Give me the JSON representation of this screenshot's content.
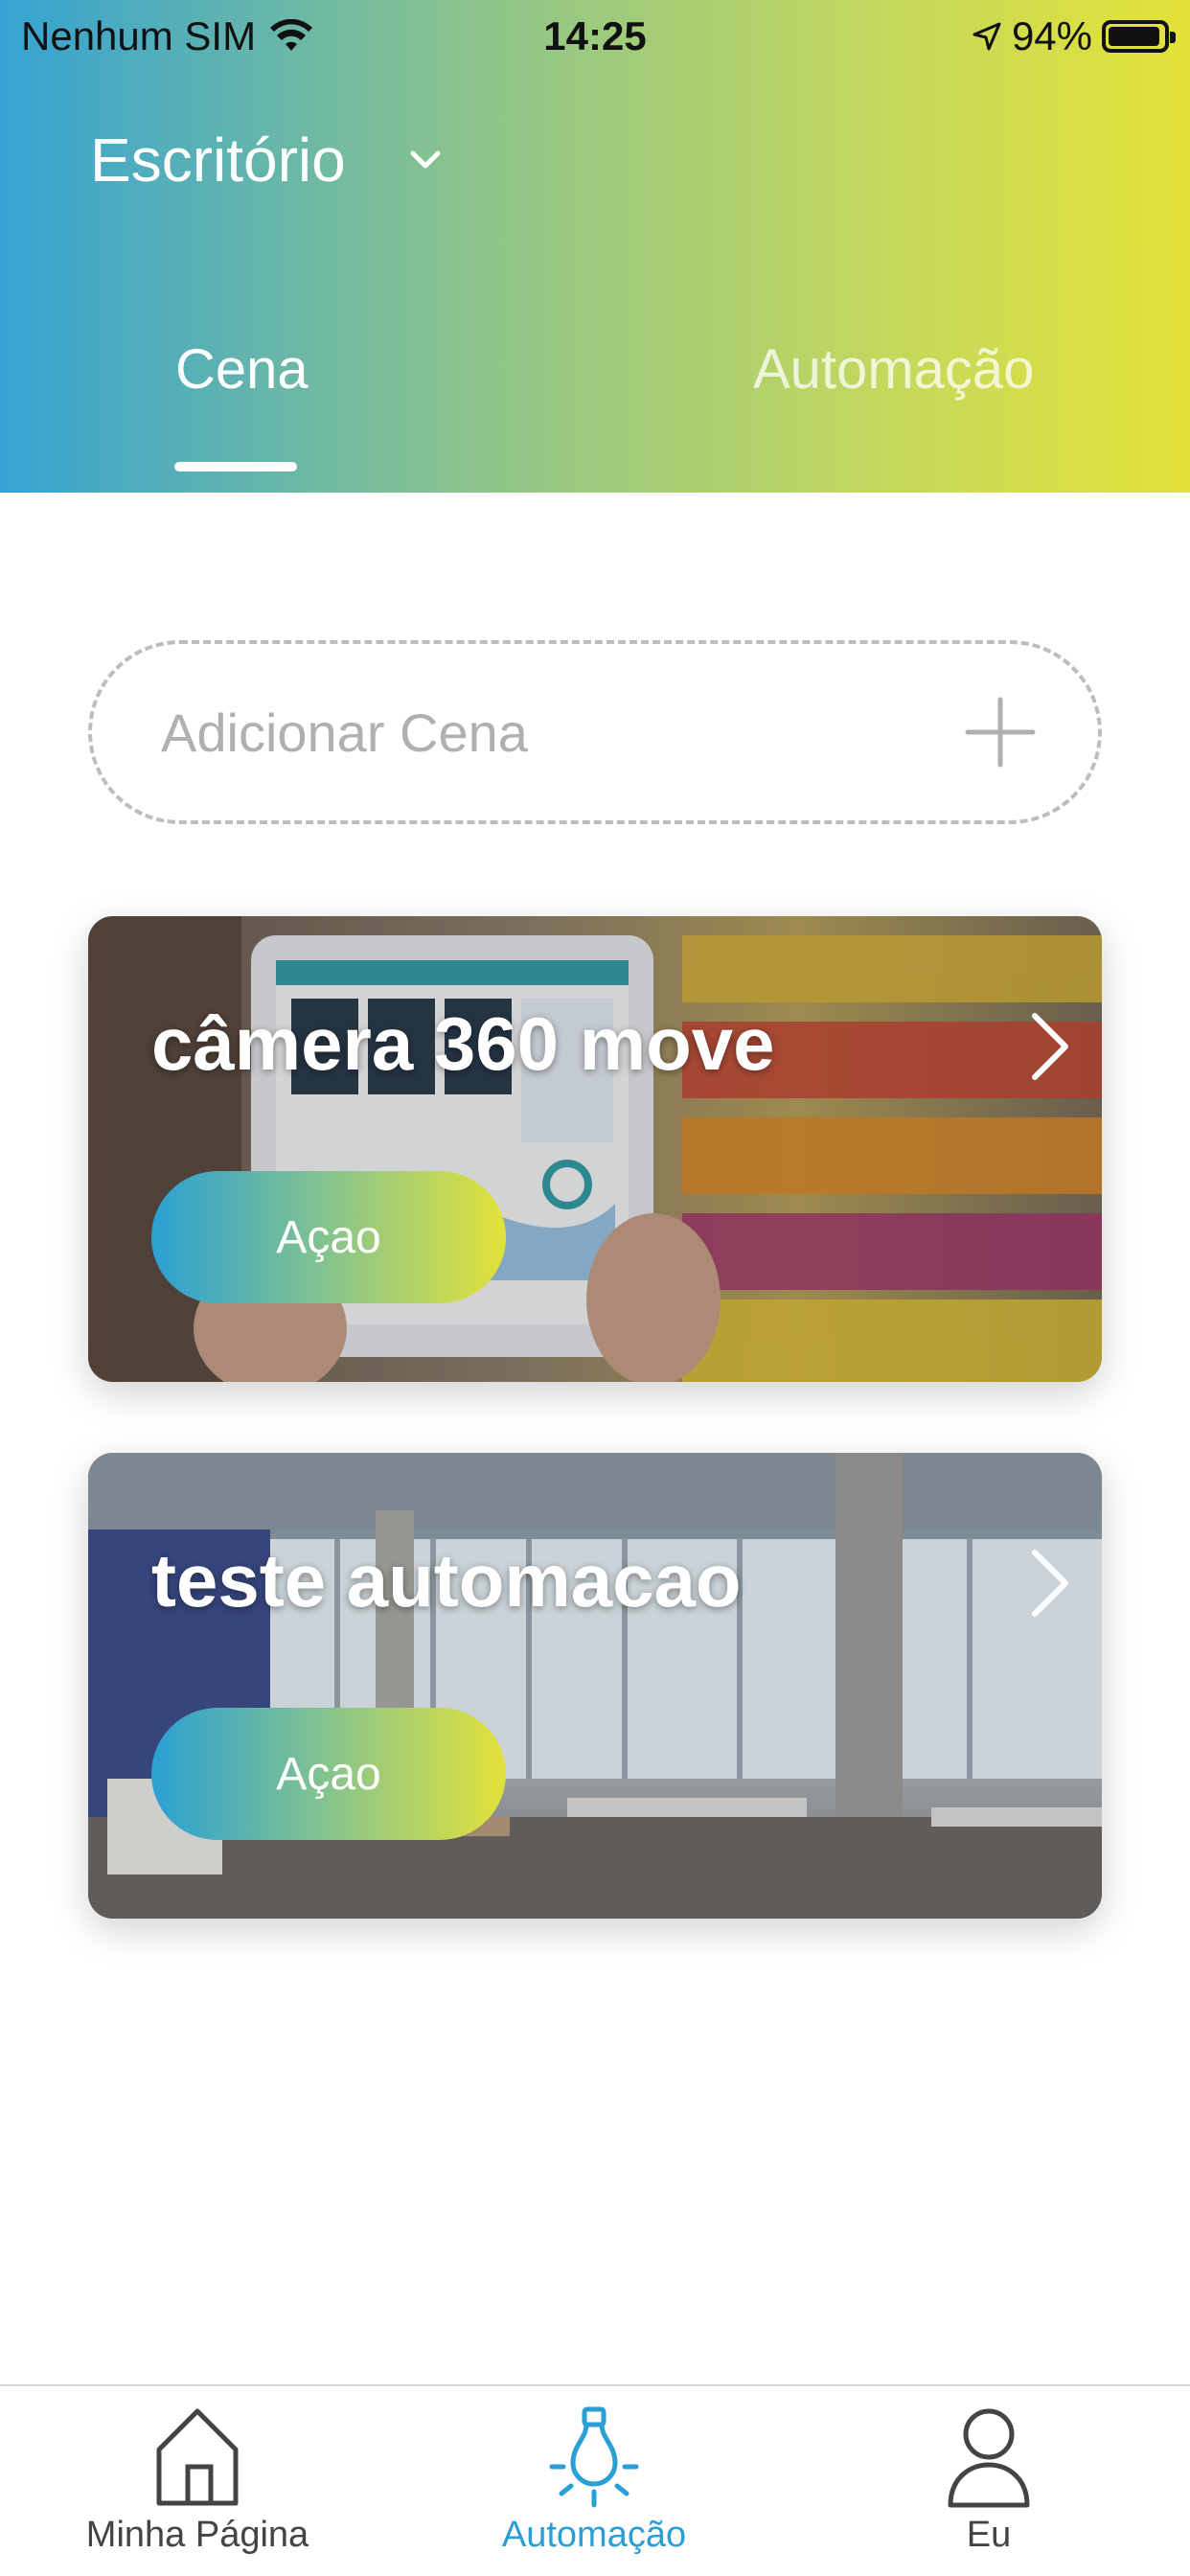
{
  "status_bar": {
    "carrier": "Nenhum SIM",
    "time": "14:25",
    "battery": "94%"
  },
  "header": {
    "home_name": "Escritório",
    "tabs": [
      {
        "label": "Cena",
        "active": true
      },
      {
        "label": "Automação",
        "active": false
      }
    ]
  },
  "add_scene": {
    "label": "Adicionar Cena"
  },
  "scenes": [
    {
      "title": "câmera 360 move",
      "action_label": "Açao"
    },
    {
      "title": "teste automacao",
      "action_label": "Açao"
    }
  ],
  "bottom_nav": [
    {
      "label": "Minha Página",
      "icon": "home-icon",
      "active": false
    },
    {
      "label": "Automação",
      "icon": "lightbulb-icon",
      "active": true
    },
    {
      "label": "Eu",
      "icon": "person-icon",
      "active": false
    }
  ],
  "colors": {
    "gradient_start": "#35a3d3",
    "gradient_end": "#e3e238",
    "active_nav": "#2a9fd6"
  }
}
